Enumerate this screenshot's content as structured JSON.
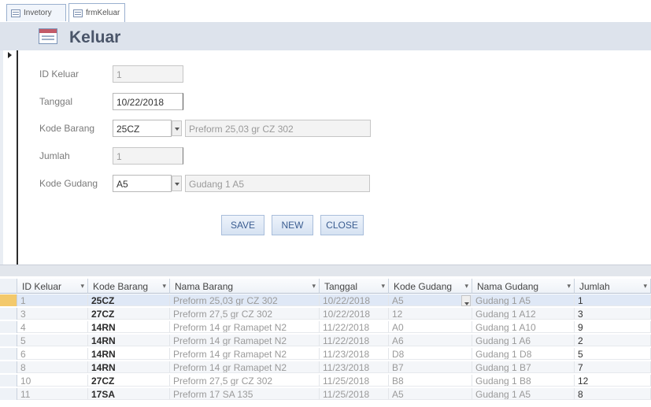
{
  "tabs": [
    {
      "label": "Invetory"
    },
    {
      "label": "frmKeluar"
    }
  ],
  "form": {
    "title": "Keluar",
    "fields": {
      "id_keluar": {
        "label": "ID Keluar",
        "value": "1"
      },
      "tanggal": {
        "label": "Tanggal",
        "value": "10/22/2018"
      },
      "kode_barang": {
        "label": "Kode Barang",
        "value": "25CZ",
        "description": "Preform 25,03 gr CZ 302"
      },
      "jumlah": {
        "label": "Jumlah",
        "value": "1"
      },
      "kode_gudang": {
        "label": "Kode Gudang",
        "value": "A5",
        "description": "Gudang 1 A5"
      }
    },
    "buttons": {
      "save": "SAVE",
      "new": "NEW",
      "close": "CLOSE"
    }
  },
  "table": {
    "columns": [
      "ID Keluar",
      "Kode Barang",
      "Nama Barang",
      "Tanggal",
      "Kode Gudang",
      "Nama Gudang",
      "Jumlah"
    ],
    "rows": [
      [
        "1",
        "25CZ",
        "Preform 25,03 gr CZ 302",
        "10/22/2018",
        "A5",
        "Gudang 1 A5",
        "1"
      ],
      [
        "3",
        "27CZ",
        "Preform 27,5 gr CZ 302",
        "10/22/2018",
        "12",
        "Gudang 1 A12",
        "3"
      ],
      [
        "4",
        "14RN",
        "Preform 14 gr Ramapet N2",
        "11/22/2018",
        "A0",
        "Gudang 1 A10",
        "9"
      ],
      [
        "5",
        "14RN",
        "Preform 14 gr Ramapet N2",
        "11/22/2018",
        "A6",
        "Gudang 1 A6",
        "2"
      ],
      [
        "6",
        "14RN",
        "Preform 14 gr Ramapet N2",
        "11/23/2018",
        "D8",
        "Gudang 1 D8",
        "5"
      ],
      [
        "8",
        "14RN",
        "Preform 14 gr Ramapet N2",
        "11/23/2018",
        "B7",
        "Gudang 1 B7",
        "7"
      ],
      [
        "10",
        "27CZ",
        "Preform 27,5 gr CZ 302",
        "11/25/2018",
        "B8",
        "Gudang 1 B8",
        "12"
      ],
      [
        "11",
        "17SA",
        "Preform 17 SA 135",
        "11/25/2018",
        "A5",
        "Gudang 1 A5",
        "8"
      ]
    ]
  }
}
